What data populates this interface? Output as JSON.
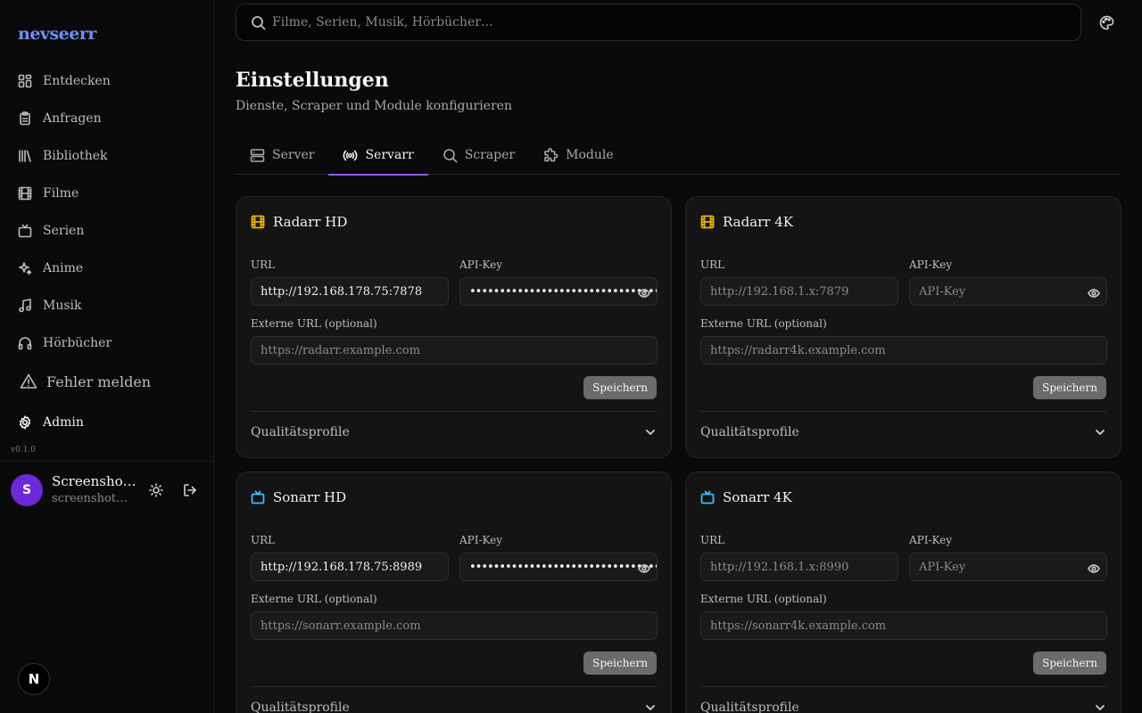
{
  "app": {
    "logo": "nevseerr",
    "version": "v0.1.0"
  },
  "search": {
    "placeholder": "Filme, Serien, Musik, Hörbücher…"
  },
  "sidebar": {
    "items": [
      {
        "label": "Entdecken",
        "icon": "grid-icon"
      },
      {
        "label": "Anfragen",
        "icon": "clipboard-icon"
      },
      {
        "label": "Bibliothek",
        "icon": "library-icon"
      },
      {
        "label": "Filme",
        "icon": "film-icon"
      },
      {
        "label": "Serien",
        "icon": "tv-icon"
      },
      {
        "label": "Anime",
        "icon": "sparkles-icon"
      },
      {
        "label": "Musik",
        "icon": "music-icon"
      },
      {
        "label": "Hörbücher",
        "icon": "headphones-icon"
      }
    ],
    "report_label": "Fehler melden",
    "admin_label": "Admin"
  },
  "user": {
    "initial": "S",
    "name": "Screenshot User",
    "email": "screenshot@test.local"
  },
  "page": {
    "title": "Einstellungen",
    "subtitle": "Dienste, Scraper und Module konfigurieren"
  },
  "tabs": [
    {
      "label": "Server",
      "icon": "server-icon",
      "active": false
    },
    {
      "label": "Servarr",
      "icon": "radio-icon",
      "active": true
    },
    {
      "label": "Scraper",
      "icon": "search-icon",
      "active": false
    },
    {
      "label": "Module",
      "icon": "puzzle-icon",
      "active": false
    }
  ],
  "labels": {
    "url": "URL",
    "api_key": "API-Key",
    "external_url": "Externe URL (optional)",
    "save": "Speichern",
    "quality_profiles": "Qualitätsprofile"
  },
  "cards": [
    {
      "title": "Radarr HD",
      "icon": "film-icon",
      "icon_color": "#eab308",
      "url_value": "http://192.168.178.75:7878",
      "url_placeholder": "",
      "api_value": "••••••••••••••••••••••••••••••••",
      "api_placeholder": "API-Key",
      "ext_placeholder": "https://radarr.example.com"
    },
    {
      "title": "Radarr 4K",
      "icon": "film-icon",
      "icon_color": "#eab308",
      "url_value": "",
      "url_placeholder": "http://192.168.1.x:7879",
      "api_value": "",
      "api_placeholder": "API-Key",
      "ext_placeholder": "https://radarr4k.example.com"
    },
    {
      "title": "Sonarr HD",
      "icon": "tv-icon",
      "icon_color": "#38bdf8",
      "url_value": "http://192.168.178.75:8989",
      "url_placeholder": "",
      "api_value": "••••••••••••••••••••••••••••••••",
      "api_placeholder": "API-Key",
      "ext_placeholder": "https://sonarr.example.com"
    },
    {
      "title": "Sonarr 4K",
      "icon": "tv-icon",
      "icon_color": "#38bdf8",
      "url_value": "",
      "url_placeholder": "http://192.168.1.x:8990",
      "api_value": "",
      "api_placeholder": "API-Key",
      "ext_placeholder": "https://sonarr4k.example.com"
    }
  ],
  "colors": {
    "accent": "#8b5cf6",
    "logo": "#6d8ef5",
    "avatar": "#6d28d9"
  }
}
